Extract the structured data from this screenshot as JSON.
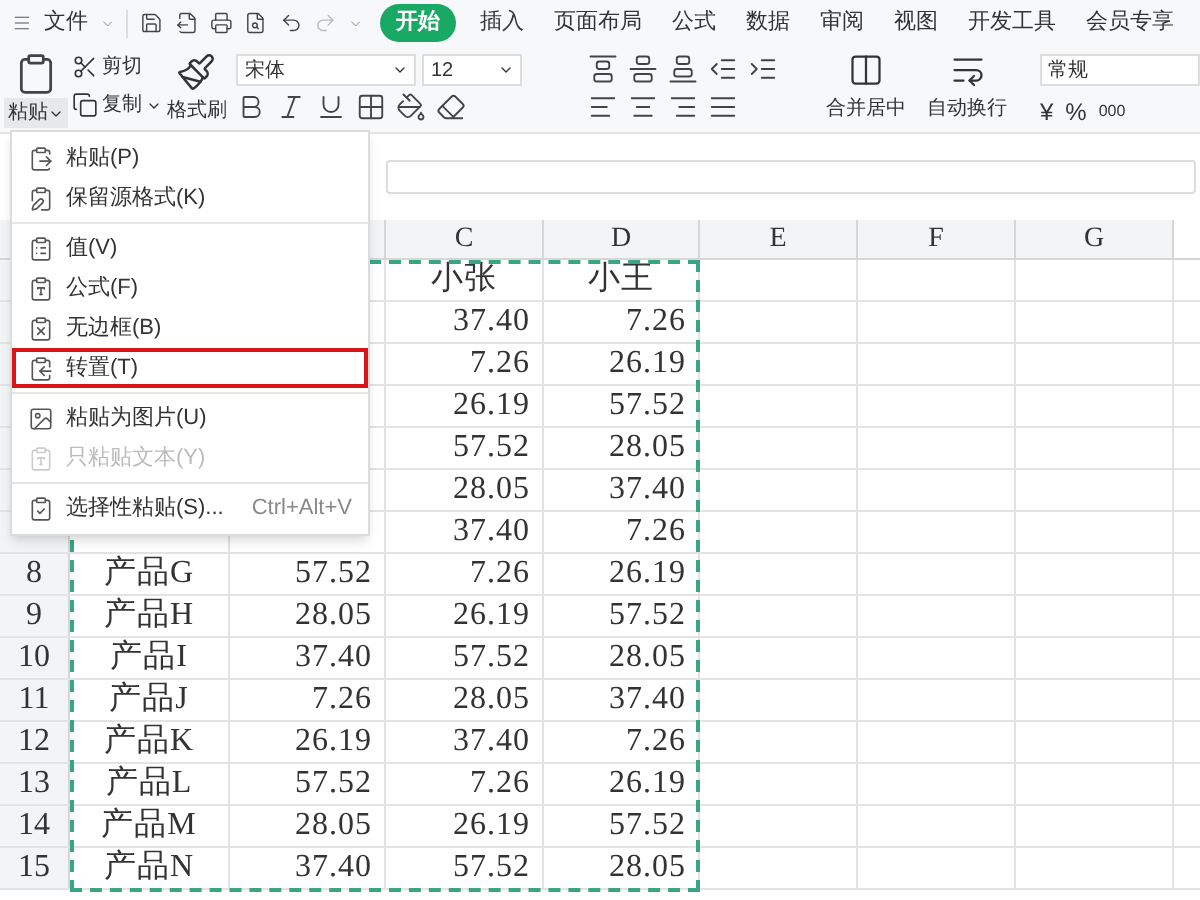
{
  "menu_bar": {
    "file": "文件",
    "tabs": [
      {
        "label": "开始",
        "selected": true
      },
      {
        "label": "插入",
        "selected": false
      },
      {
        "label": "页面布局",
        "selected": false
      },
      {
        "label": "公式",
        "selected": false
      },
      {
        "label": "数据",
        "selected": false
      },
      {
        "label": "审阅",
        "selected": false
      },
      {
        "label": "视图",
        "selected": false
      },
      {
        "label": "开发工具",
        "selected": false
      },
      {
        "label": "会员专享",
        "selected": false
      }
    ]
  },
  "ribbon": {
    "paste": "粘贴",
    "cut": "剪切",
    "copy": "复制",
    "format_painter": "格式刷",
    "font": "宋体",
    "font_size": "12",
    "merge": "合并居中",
    "wrap": "自动换行",
    "number_format": "常规",
    "currency": "¥",
    "percent": "%",
    "thousands": "000"
  },
  "paste_menu": {
    "groups": [
      [
        {
          "label": "粘贴(P)",
          "highlighted": false,
          "disabled": false
        },
        {
          "label": "保留源格式(K)",
          "highlighted": false,
          "disabled": false
        }
      ],
      [
        {
          "label": "值(V)",
          "highlighted": false,
          "disabled": false
        },
        {
          "label": "公式(F)",
          "highlighted": false,
          "disabled": false
        },
        {
          "label": "无边框(B)",
          "highlighted": false,
          "disabled": false
        },
        {
          "label": "转置(T)",
          "highlighted": true,
          "disabled": false
        }
      ],
      [
        {
          "label": "粘贴为图片(U)",
          "highlighted": false,
          "disabled": false
        },
        {
          "label": "只粘贴文本(Y)",
          "highlighted": false,
          "disabled": true
        }
      ],
      [
        {
          "label": "选择性粘贴(S)...",
          "shortcut": "Ctrl+Alt+V",
          "highlighted": false,
          "disabled": false
        }
      ]
    ]
  },
  "sheet": {
    "columns": [
      "",
      "",
      "C",
      "D",
      "E",
      "F",
      "G"
    ],
    "rows": [
      {
        "cells": [
          null,
          null,
          "小张",
          "小王"
        ]
      },
      {
        "cells": [
          null,
          null,
          "37.40",
          "7.26"
        ]
      },
      {
        "cells": [
          null,
          null,
          "7.26",
          "26.19"
        ]
      },
      {
        "cells": [
          null,
          null,
          "26.19",
          "57.52"
        ]
      },
      {
        "cells": [
          null,
          null,
          "57.52",
          "28.05"
        ]
      },
      {
        "cells": [
          null,
          null,
          "28.05",
          "37.40"
        ]
      },
      {
        "cells": [
          null,
          null,
          "37.40",
          "7.26"
        ]
      },
      {
        "number": "8",
        "cells": [
          "产品G",
          "57.52",
          "7.26",
          "26.19"
        ]
      },
      {
        "number": "9",
        "cells": [
          "产品H",
          "28.05",
          "26.19",
          "57.52"
        ]
      },
      {
        "number": "10",
        "cells": [
          "产品I",
          "37.40",
          "57.52",
          "28.05"
        ]
      },
      {
        "number": "11",
        "cells": [
          "产品J",
          "7.26",
          "28.05",
          "37.40"
        ]
      },
      {
        "number": "12",
        "cells": [
          "产品K",
          "26.19",
          "37.40",
          "7.26"
        ]
      },
      {
        "number": "13",
        "cells": [
          "产品L",
          "57.52",
          "7.26",
          "26.19"
        ]
      },
      {
        "number": "14",
        "cells": [
          "产品M",
          "28.05",
          "26.19",
          "57.52"
        ]
      },
      {
        "number": "15",
        "cells": [
          "产品N",
          "37.40",
          "57.52",
          "28.05"
        ]
      }
    ]
  }
}
